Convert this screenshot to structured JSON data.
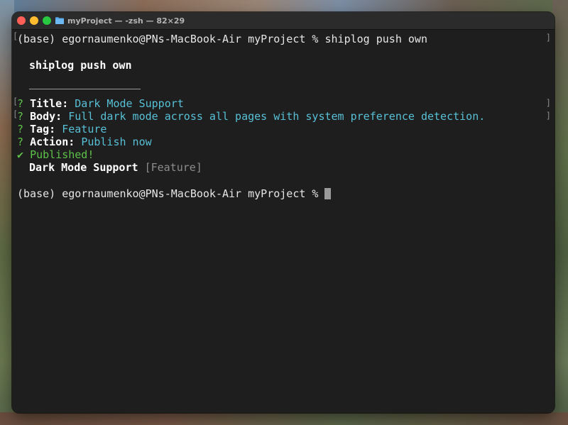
{
  "window": {
    "title": "myProject — -zsh — 82×29"
  },
  "terminal": {
    "prompt_line": "(base) egornaumenko@PNs-MacBook-Air myProject % shiplog push own",
    "heading": "shiplog push own",
    "title_q": "?",
    "title_label": "Title:",
    "title_value": "Dark Mode Support",
    "body_q": "?",
    "body_label": "Body:",
    "body_value": "Full dark mode across all pages with system preference detection.",
    "tag_q": "?",
    "tag_label": "Tag:",
    "tag_value": "Feature",
    "action_q": "?",
    "action_label": "Action:",
    "action_value": "Publish now",
    "published_mark": "✔",
    "published_text": "Published!",
    "result_title": "Dark Mode Support",
    "result_tag": "[Feature]",
    "final_prompt": "(base) egornaumenko@PNs-MacBook-Air myProject % "
  },
  "colors": {
    "close": "#ff5f57",
    "minimize": "#febc2e",
    "maximize": "#28c840",
    "success_green": "#5ec24a",
    "answer_cyan": "#57c0d6",
    "terminal_bg": "#1e1e1e"
  },
  "icons": {
    "title_icon": "folder-icon"
  }
}
